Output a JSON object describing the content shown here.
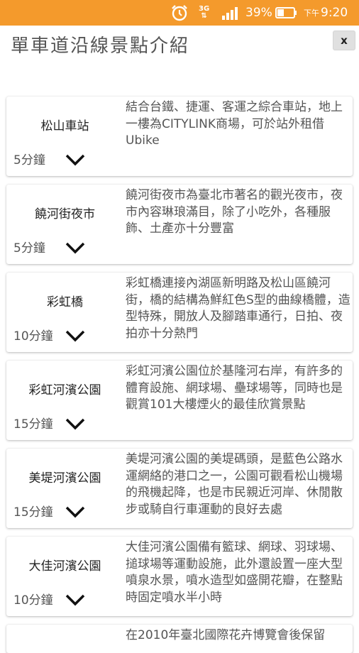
{
  "status_bar": {
    "network": "3G",
    "battery_percent": "39%",
    "time_period": "下午",
    "time": "9:20"
  },
  "header": {
    "title": "單車道沿線景點介紹",
    "close_label": "x"
  },
  "spots": [
    {
      "name": "松山車站",
      "duration": "5分鐘",
      "description": "結合台鐵、捷運、客運之綜合車站，地上一樓為CITYLINK商場，可於站外租借Ubike"
    },
    {
      "name": "饒河街夜市",
      "duration": "5分鐘",
      "description": " 饒河街夜市為臺北市著名的觀光夜市，夜市內容琳琅滿目，除了小吃外，各種服飾、土產亦十分豐富"
    },
    {
      "name": "彩虹橋",
      "duration": "10分鐘",
      "description": " 彩虹橋連接內湖區新明路及松山區饒河街，橋的結構為鮮紅色S型的曲線橋體，造型特殊，開放人及腳踏車通行，日拍、夜拍亦十分熱門"
    },
    {
      "name": "彩虹河濱公園",
      "duration": "15分鐘",
      "description": " 彩虹河濱公園位於基隆河右岸，有許多的體育設施、網球場、壘球場等，同時也是觀賞101大樓煙火的最佳欣賞景點"
    },
    {
      "name": "美堤河濱公園",
      "duration": "15分鐘",
      "description": " 美堤河濱公園的美堤碼頭，是藍色公路水運網絡的港口之一，公園可觀看松山機場的飛機起降，也是市民親近河岸、休閒散步或騎自行車運動的良好去處"
    },
    {
      "name": "大佳河濱公園",
      "duration": "10分鐘",
      "description": " 大佳河濱公園備有籃球、網球、羽球場、搥球場等運動設施，此外還設置一座大型噴泉水景，噴水造型如盛開花瓣，在整點時固定噴水半小時"
    },
    {
      "name": "",
      "duration": "",
      "description": " 在2010年臺北國際花卉博覽會後保留"
    }
  ]
}
